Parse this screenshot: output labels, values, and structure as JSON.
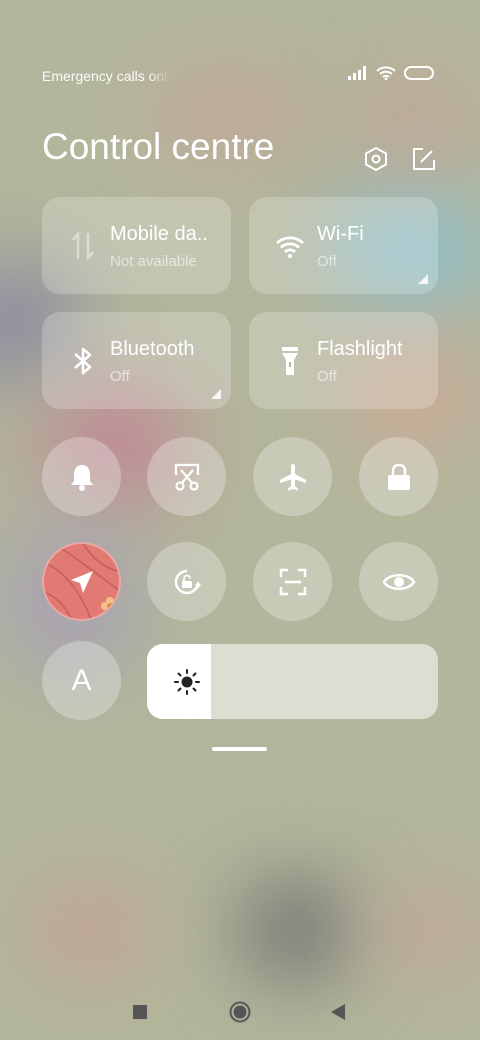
{
  "status_bar": {
    "carrier_text": "Emergency calls only",
    "icons": [
      "signal-icon",
      "wifi-icon",
      "battery-icon"
    ]
  },
  "header": {
    "title": "Control centre",
    "icons": [
      "settings-hexagon-icon",
      "edit-icon"
    ]
  },
  "tiles": [
    {
      "label": "Mobile da..",
      "sub": "Not available",
      "icon": "mobile-data-icon"
    },
    {
      "label": "Wi-Fi",
      "sub": "Off",
      "icon": "wifi-icon"
    },
    {
      "label": "Bluetooth",
      "sub": "Off",
      "icon": "bluetooth-icon"
    },
    {
      "label": "Flashlight",
      "sub": "Off",
      "icon": "flashlight-icon"
    }
  ],
  "toggles": [
    "bell-icon",
    "screenshot-icon",
    "airplane-icon",
    "lock-icon",
    "location-icon",
    "rotation-lock-icon",
    "scan-icon",
    "eye-icon",
    "font-size-icon"
  ],
  "font_toggle_label": "A",
  "brightness": {
    "level": 0.22,
    "icon": "sun-icon"
  },
  "nav_bar": [
    "recents-icon",
    "home-icon",
    "back-icon"
  ],
  "colors": {
    "background": "#b3b69c",
    "location_active": "#e07a72"
  }
}
